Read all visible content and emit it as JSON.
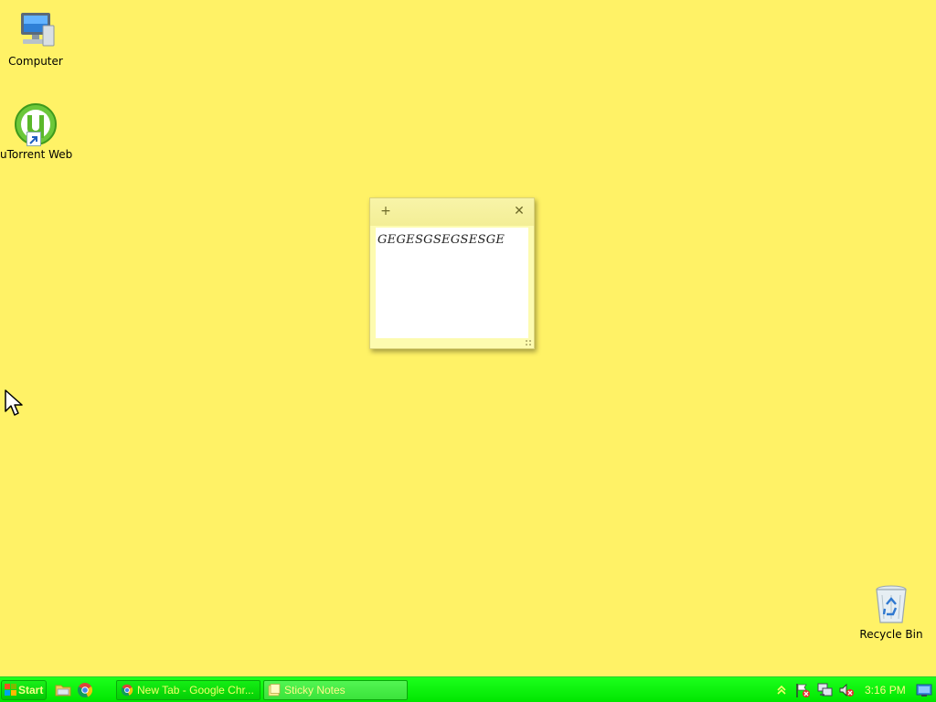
{
  "desktop": {
    "background_color": "#fff266",
    "icons": [
      {
        "label": "Computer",
        "icon": "computer-icon"
      },
      {
        "label": "uTorrent Web",
        "icon": "utorrent-icon"
      },
      {
        "label": "Recycle Bin",
        "icon": "recycle-bin-icon"
      }
    ]
  },
  "sticky_note": {
    "add_symbol": "+",
    "close_symbol": "✕",
    "text": "GEGESGSEGSESGE",
    "colors": {
      "paper": "#fdfbb0",
      "body": "#ffffff"
    }
  },
  "taskbar": {
    "color": "#00e600",
    "start_label": "Start",
    "quick_launch": [
      {
        "icon": "file-explorer-icon"
      },
      {
        "icon": "chrome-icon"
      }
    ],
    "tasks": [
      {
        "label": "New Tab - Google Chr...",
        "icon": "chrome-icon",
        "active": false
      },
      {
        "label": "Sticky Notes",
        "icon": "sticky-notes-icon",
        "active": true
      }
    ],
    "tray": {
      "icons": [
        "show-hidden-icons-icon",
        "action-center-flag-icon",
        "network-icon",
        "volume-muted-icon"
      ],
      "clock": "3:16 PM"
    }
  }
}
